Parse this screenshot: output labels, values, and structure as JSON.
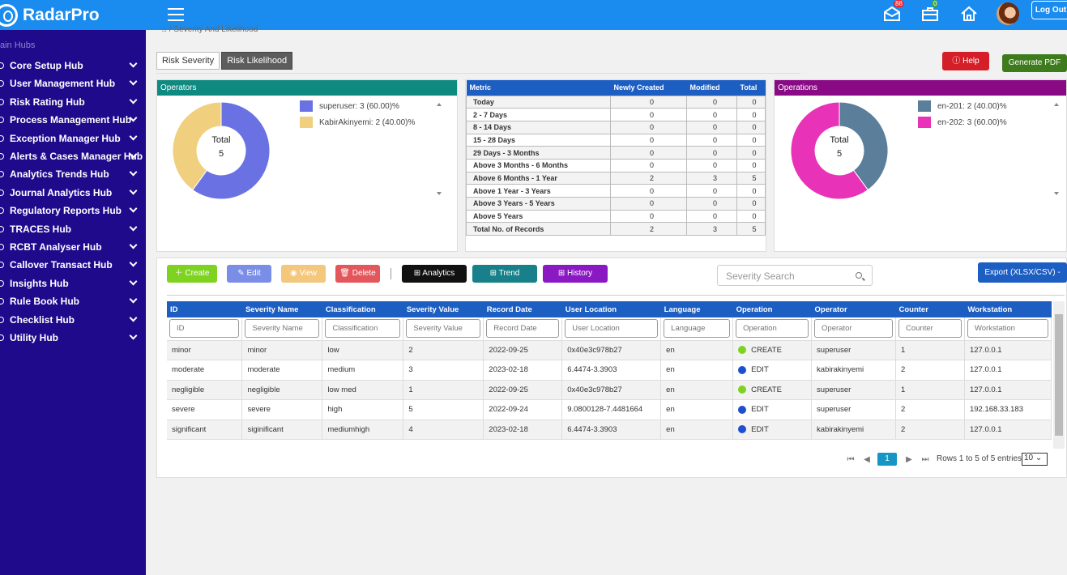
{
  "brand": {
    "name": "RadarPro"
  },
  "topbar": {
    "inbox_count": "88",
    "briefcase_count": "0",
    "logout_label": "Log Out"
  },
  "sidebar": {
    "title": "ain Hubs",
    "items": [
      {
        "label": "Core Setup Hub"
      },
      {
        "label": "User Management Hub"
      },
      {
        "label": "Risk Rating Hub"
      },
      {
        "label": "Process Management Hub"
      },
      {
        "label": "Exception Manager Hub"
      },
      {
        "label": "Alerts & Cases Manager Hub"
      },
      {
        "label": "Analytics Trends Hub"
      },
      {
        "label": "Journal Analytics Hub"
      },
      {
        "label": "Regulatory Reports Hub"
      },
      {
        "label": "TRACES Hub"
      },
      {
        "label": "RCBT Analyser Hub"
      },
      {
        "label": "Callover Transact Hub"
      },
      {
        "label": "Insights Hub"
      },
      {
        "label": "Rule Book Hub"
      },
      {
        "label": "Checklist Hub"
      },
      {
        "label": "Utility Hub"
      }
    ]
  },
  "breadcrumb": "/ Severity And Likelihood",
  "tabs": [
    {
      "label": "Risk Severity",
      "active": false
    },
    {
      "label": "Risk Likelihood",
      "active": true
    }
  ],
  "actions": {
    "help": "Help",
    "generate_pdf": "Generate PDF"
  },
  "operators_panel": {
    "title": "Operators",
    "total_label": "Total",
    "total_value": "5",
    "legend": [
      {
        "label": "superuser: 3 (60.00)%",
        "color": "#6a72e3"
      },
      {
        "label": "KabirAkinyemi: 2 (40.00)%",
        "color": "#f0d07e"
      }
    ]
  },
  "operations_panel": {
    "title": "Operations",
    "total_label": "Total",
    "total_value": "5",
    "legend": [
      {
        "label": "en-201: 2 (40.00)%",
        "color": "#5b7e9a"
      },
      {
        "label": "en-202: 3 (60.00)%",
        "color": "#e832b8"
      }
    ]
  },
  "metric_table": {
    "headers": [
      "Metric",
      "Newly Created",
      "Modified",
      "Total"
    ],
    "rows": [
      [
        "Today",
        "0",
        "0",
        "0"
      ],
      [
        "2 - 7 Days",
        "0",
        "0",
        "0"
      ],
      [
        "8 - 14 Days",
        "0",
        "0",
        "0"
      ],
      [
        "15 - 28 Days",
        "0",
        "0",
        "0"
      ],
      [
        "29 Days - 3 Months",
        "0",
        "0",
        "0"
      ],
      [
        "Above 3 Months - 6 Months",
        "0",
        "0",
        "0"
      ],
      [
        "Above 6 Months - 1 Year",
        "2",
        "3",
        "5"
      ],
      [
        "Above 1 Year - 3 Years",
        "0",
        "0",
        "0"
      ],
      [
        "Above 3 Years - 5 Years",
        "0",
        "0",
        "0"
      ],
      [
        "Above 5 Years",
        "0",
        "0",
        "0"
      ],
      [
        "Total No. of Records",
        "2",
        "3",
        "5"
      ]
    ]
  },
  "toolbar": {
    "create": "Create",
    "edit": "Edit",
    "view": "View",
    "delete": "Delete",
    "analytics": "Analytics",
    "trend": "Trend",
    "history": "History",
    "search_placeholder": "Severity Search",
    "export": "Export (XLSX/CSV) -"
  },
  "data_table": {
    "headers": [
      "ID",
      "Severity Name",
      "Classification",
      "Severity Value",
      "Record Date",
      "User Location",
      "Language",
      "Operation",
      "Operator",
      "Counter",
      "Workstation"
    ],
    "filters": [
      "ID",
      "Severity Name",
      "Classification",
      "Severity Value",
      "Record Date",
      "User Location",
      "Language",
      "Operation",
      "Operator",
      "Counter",
      "Workstation"
    ],
    "rows": [
      [
        "minor",
        "minor",
        "low",
        "2",
        "2022-09-25",
        "0x40e3c978b27",
        "en",
        "CREATE",
        "superuser",
        "1",
        "127.0.0.1"
      ],
      [
        "moderate",
        "moderate",
        "medium",
        "3",
        "2023-02-18",
        "6.4474-3.3903",
        "en",
        "EDIT",
        "kabirakinyemi",
        "2",
        "127.0.0.1"
      ],
      [
        "negligible",
        "negligible",
        "low med",
        "1",
        "2022-09-25",
        "0x40e3c978b27",
        "en",
        "CREATE",
        "superuser",
        "1",
        "127.0.0.1"
      ],
      [
        "severe",
        "severe",
        "high",
        "5",
        "2022-09-24",
        "9.0800128-7.4481664",
        "en",
        "EDIT",
        "superuser",
        "2",
        "192.168.33.183"
      ],
      [
        "significant",
        "siginificant",
        "mediumhigh",
        "4",
        "2023-02-18",
        "6.4474-3.3903",
        "en",
        "EDIT",
        "kabirakinyemi",
        "2",
        "127.0.0.1"
      ]
    ],
    "op_colors": {
      "CREATE": "#7ed321",
      "EDIT": "#1f4fd0"
    }
  },
  "pagination": {
    "current_page": "1",
    "rows_info": "Rows 1 to 5 of 5 entries",
    "page_size": "10"
  },
  "colors": {
    "sidebar": "#1f0a8c",
    "topbar": "#1a8cf0",
    "operators_header": "#0e8a80",
    "metric_header": "#1d5ec2",
    "operations_header": "#8a0a86"
  }
}
